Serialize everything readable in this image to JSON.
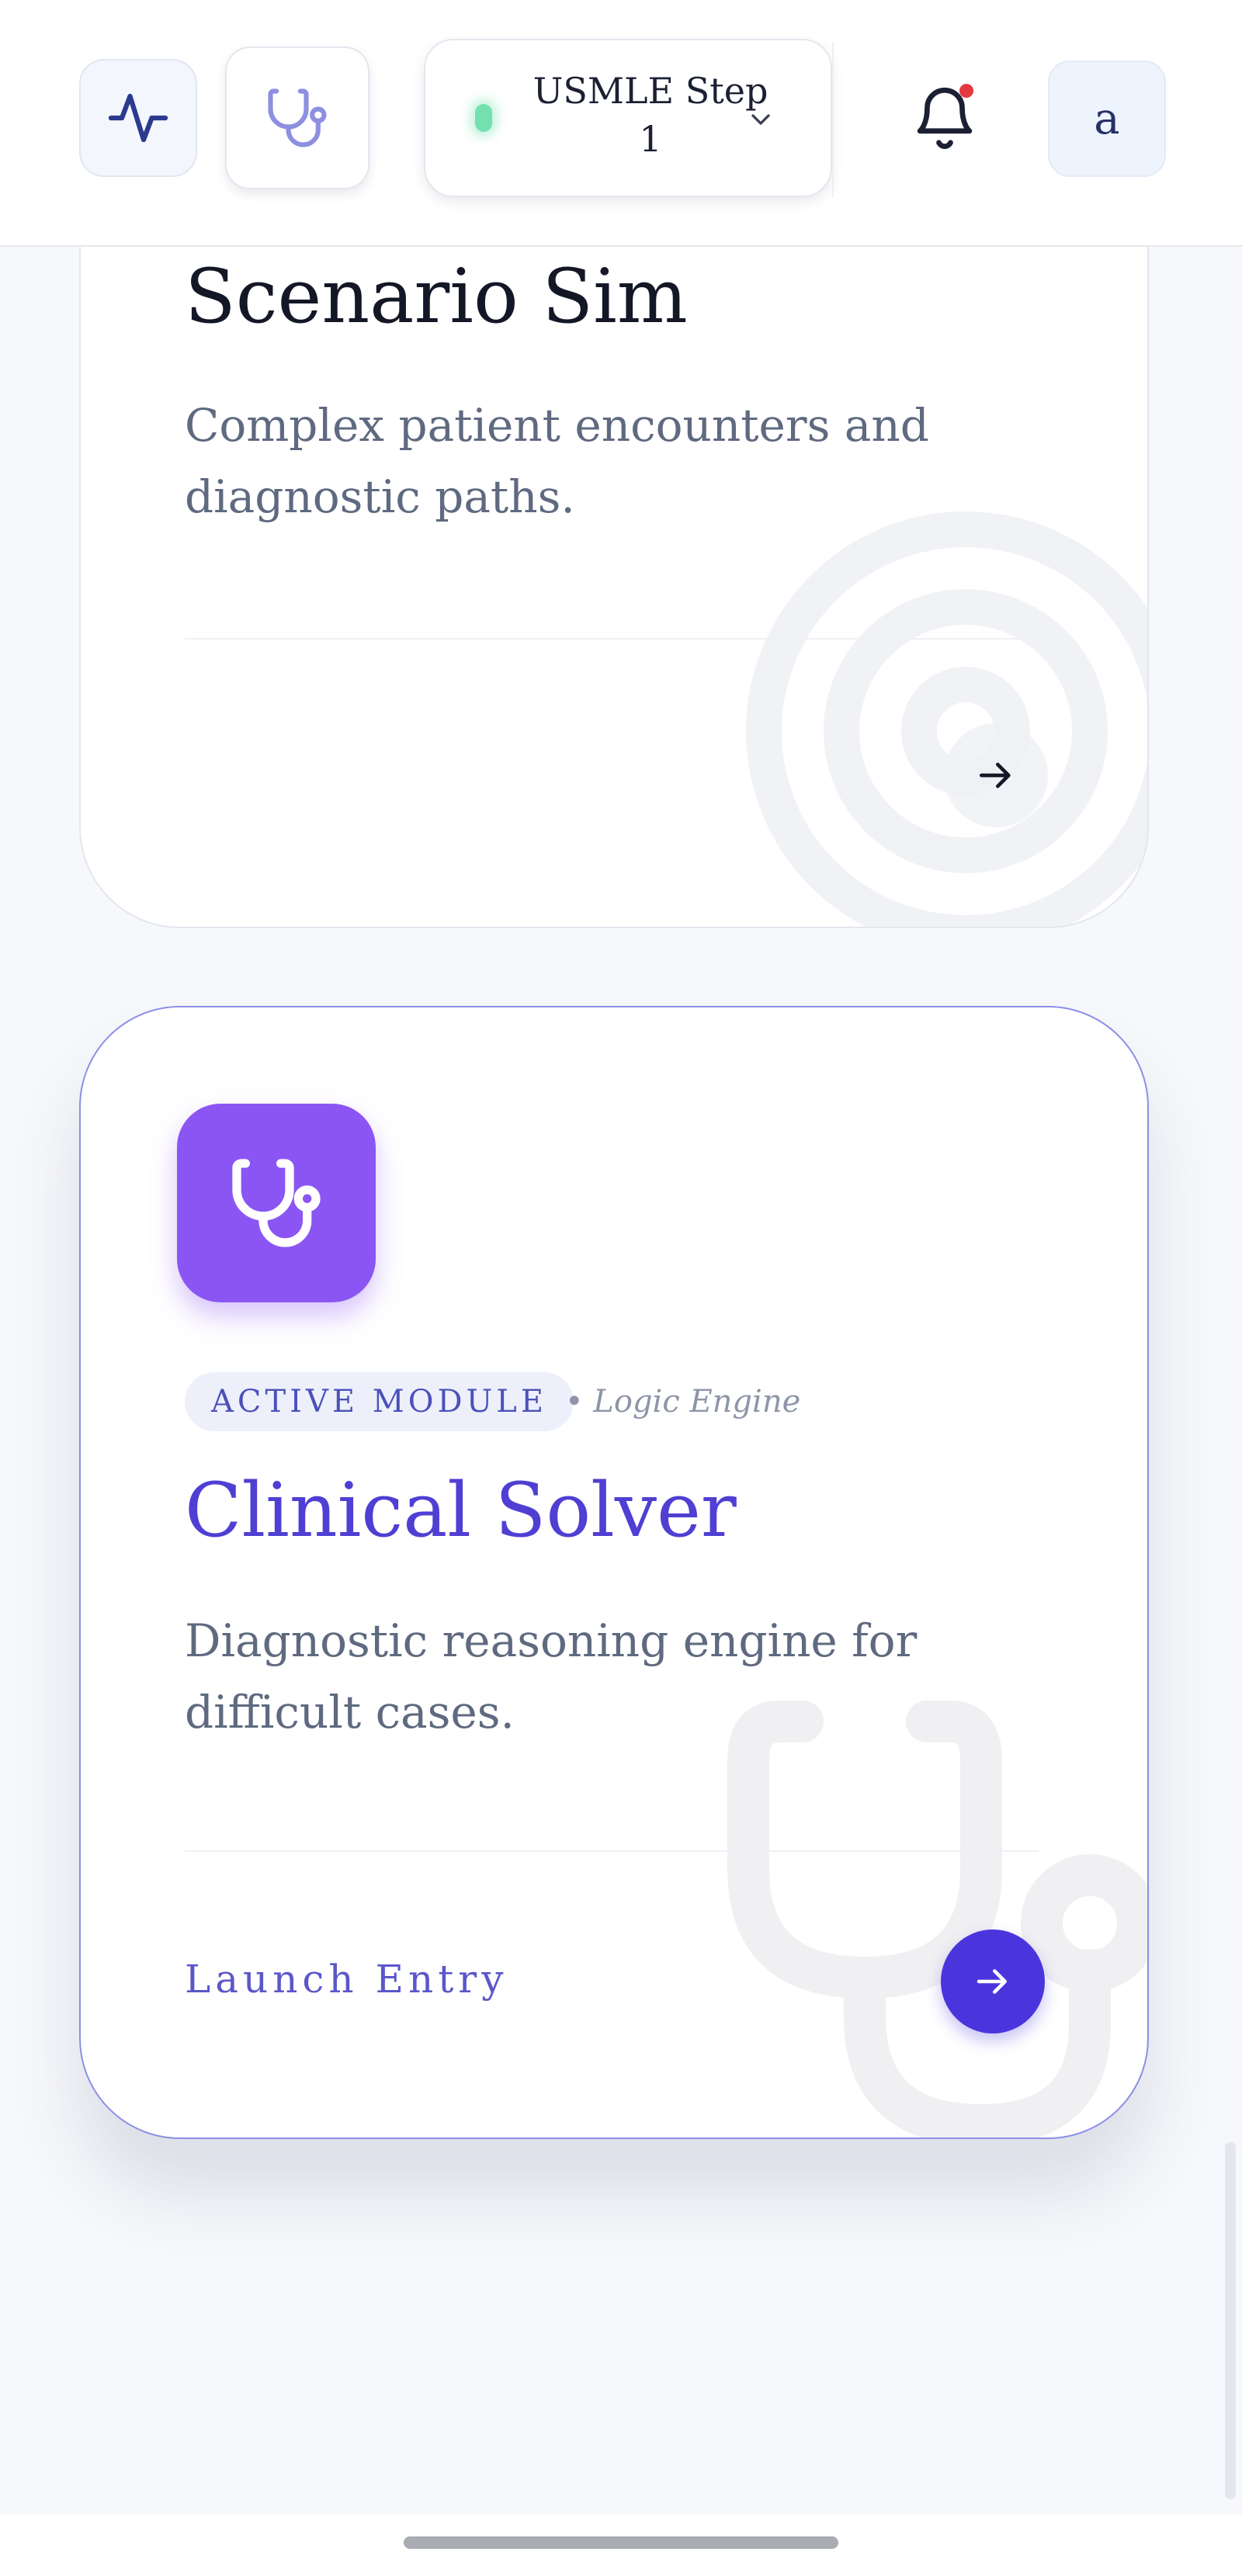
{
  "header": {
    "exam_selector": {
      "label": "USMLE Step 1",
      "status_color": "#74e0b0"
    },
    "avatar_initial": "a",
    "notification_badge_color": "#e5393f"
  },
  "cards": [
    {
      "title": "Scenario Sim",
      "description": "Complex patient encounters and diagnostic paths.",
      "decor_icon": "target-icon",
      "action_icon": "arrow-right-icon"
    },
    {
      "icon": "stethoscope-icon",
      "badge": "ACTIVE MODULE",
      "meta": "• Logic Engine",
      "title": "Clinical Solver",
      "description": "Diagnostic reasoning engine for difficult cases.",
      "cta": "Launch Entry",
      "action_icon": "arrow-right-icon",
      "accent_color": "#4f3fd3",
      "icon_bg_color": "#8b55f3"
    }
  ]
}
